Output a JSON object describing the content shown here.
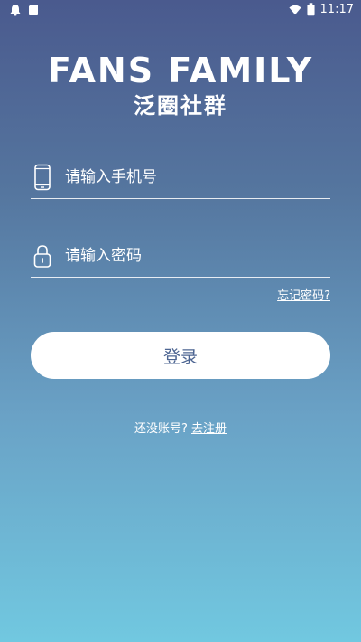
{
  "status_bar": {
    "time": "11:17",
    "left_icons": [
      "notification-bell-icon",
      "sd-card-icon"
    ],
    "right_icons": [
      "wifi-icon",
      "battery-icon"
    ]
  },
  "brand": {
    "title": "FANS FAMILY",
    "subtitle": "泛圈社群"
  },
  "form": {
    "phone": {
      "placeholder": "请输入手机号",
      "value": "",
      "icon": "phone-icon"
    },
    "password": {
      "placeholder": "请输入密码",
      "value": "",
      "icon": "lock-icon"
    },
    "forgot_label": "忘记密码?",
    "login_label": "登录"
  },
  "register": {
    "prompt": "还没账号?",
    "link_label": "去注册"
  },
  "colors": {
    "gradient_top": "#4a5a8e",
    "gradient_bottom": "#71c8e0",
    "button_text": "#4d6592"
  }
}
